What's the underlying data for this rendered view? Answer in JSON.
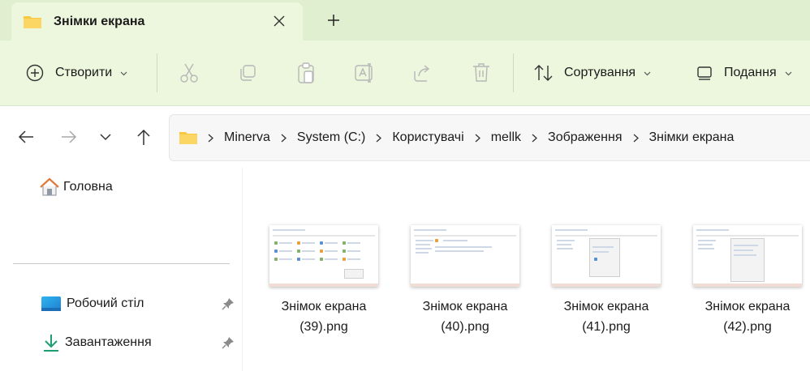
{
  "tab": {
    "title": "Знімки екрана"
  },
  "toolbar": {
    "new_label": "Створити",
    "sort_label": "Сортування",
    "view_label": "Подання"
  },
  "breadcrumb": [
    "Minerva",
    "System (C:)",
    "Користувачі",
    "mellk",
    "Зображення",
    "Знімки екрана"
  ],
  "sidebar": {
    "home": "Головна",
    "desktop": "Робочий стіл",
    "downloads": "Завантаження"
  },
  "files": [
    {
      "line1": "Знімок екрана",
      "line2": "(39).png"
    },
    {
      "line1": "Знімок екрана",
      "line2": "(40).png"
    },
    {
      "line1": "Знімок екрана",
      "line2": "(41).png"
    },
    {
      "line1": "Знімок екрана",
      "line2": "(42).png"
    }
  ],
  "colors": {
    "accent_bg": "#ecf7de",
    "titlebar_bg": "#dfefcf",
    "folder": "#f8c93e"
  }
}
